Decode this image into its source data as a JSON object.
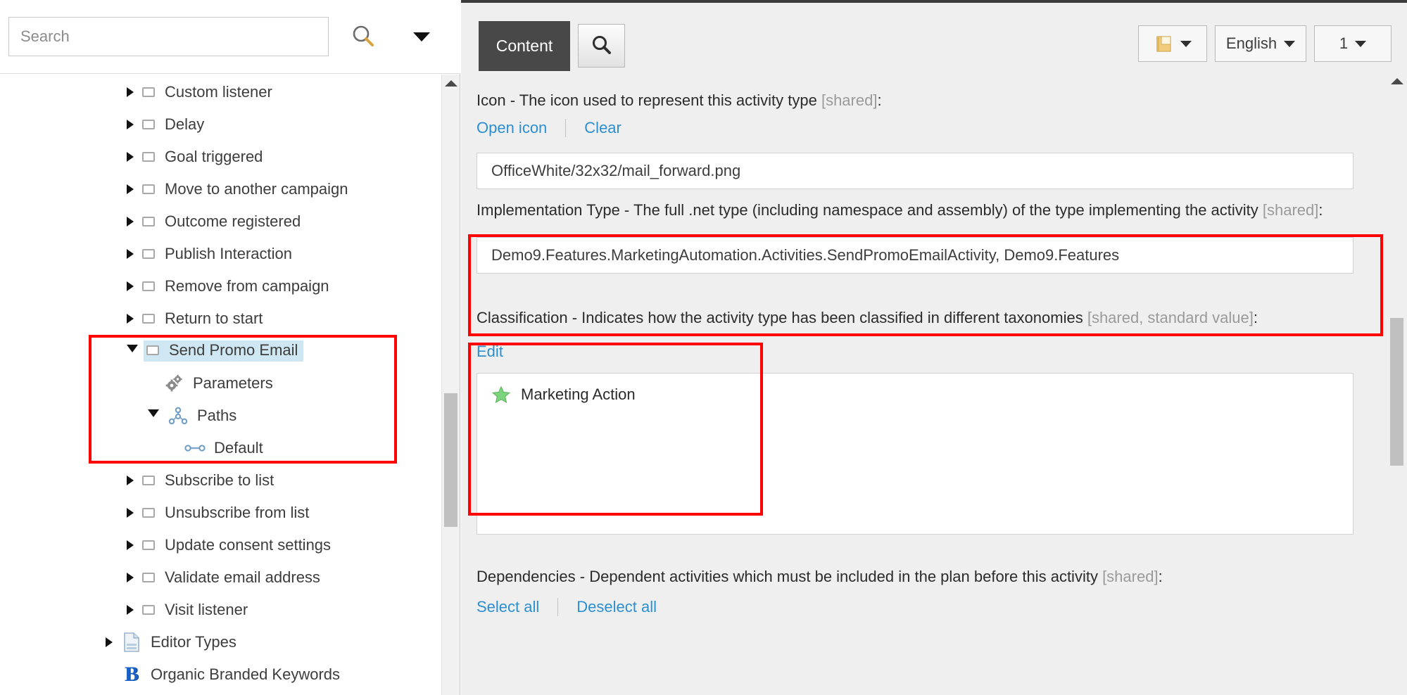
{
  "left_panel": {
    "search": {
      "placeholder": "Search",
      "value": "",
      "search_icon": "search-icon",
      "caret_icon": "chevron-down-icon"
    },
    "tree": [
      {
        "label": "Custom listener",
        "indent": 1,
        "expander": "collapsed",
        "icon": "square-icon",
        "selected": false
      },
      {
        "label": "Delay",
        "indent": 1,
        "expander": "collapsed",
        "icon": "square-icon",
        "selected": false
      },
      {
        "label": "Goal triggered",
        "indent": 1,
        "expander": "collapsed",
        "icon": "square-icon",
        "selected": false
      },
      {
        "label": "Move to another campaign",
        "indent": 1,
        "expander": "collapsed",
        "icon": "square-icon",
        "selected": false
      },
      {
        "label": "Outcome registered",
        "indent": 1,
        "expander": "collapsed",
        "icon": "square-icon",
        "selected": false
      },
      {
        "label": "Publish Interaction",
        "indent": 1,
        "expander": "collapsed",
        "icon": "square-icon",
        "selected": false
      },
      {
        "label": "Remove from campaign",
        "indent": 1,
        "expander": "collapsed",
        "icon": "square-icon",
        "selected": false
      },
      {
        "label": "Return to start",
        "indent": 1,
        "expander": "collapsed",
        "icon": "square-icon",
        "selected": false
      },
      {
        "label": "Send Promo Email",
        "indent": 1,
        "expander": "expanded",
        "icon": "square-icon",
        "selected": true
      },
      {
        "label": "Parameters",
        "indent": 2,
        "expander": "none",
        "icon": "gears-icon",
        "selected": false
      },
      {
        "label": "Paths",
        "indent": 2,
        "expander": "expanded",
        "icon": "node-tree-icon",
        "selected": false
      },
      {
        "label": "Default",
        "indent": 3,
        "expander": "none",
        "icon": "link-icon",
        "selected": false
      },
      {
        "label": "Subscribe to list",
        "indent": 1,
        "expander": "collapsed",
        "icon": "square-icon",
        "selected": false
      },
      {
        "label": "Unsubscribe from list",
        "indent": 1,
        "expander": "collapsed",
        "icon": "square-icon",
        "selected": false
      },
      {
        "label": "Update consent settings",
        "indent": 1,
        "expander": "collapsed",
        "icon": "square-icon",
        "selected": false
      },
      {
        "label": "Validate email address",
        "indent": 1,
        "expander": "collapsed",
        "icon": "square-icon",
        "selected": false
      },
      {
        "label": "Visit listener",
        "indent": 1,
        "expander": "collapsed",
        "icon": "square-icon",
        "selected": false
      },
      {
        "label": "Editor Types",
        "indent": 0,
        "expander": "collapsed",
        "icon": "document-icon",
        "selected": false
      },
      {
        "label": "Organic Branded Keywords",
        "indent": 0,
        "expander": "none",
        "icon": "b-logo-icon",
        "selected": false
      }
    ]
  },
  "right_panel": {
    "toolbar": {
      "tab_label": "Content",
      "search_button_icon": "search-icon",
      "book_button_icon": "notebook-icon",
      "language_label": "English",
      "number_label": "1",
      "caret_icon": "chevron-down-icon"
    },
    "fields": {
      "icon_field": {
        "label_main": "Icon - The icon used to represent this activity type ",
        "label_dim": "[shared]",
        "label_tail": ":",
        "link_open": "Open icon",
        "link_clear": "Clear",
        "value": "OfficeWhite/32x32/mail_forward.png"
      },
      "implementation_type": {
        "label_main": "Implementation Type - The full .net type (including namespace and assembly) of the type implementing the activity ",
        "label_dim": "[shared]",
        "label_tail": ":",
        "value": "Demo9.Features.MarketingAutomation.Activities.SendPromoEmailActivity, Demo9.Features"
      },
      "classification": {
        "label_main": "Classification - Indicates how the activity type has been classified in different taxonomies ",
        "label_dim": "[shared, standard value]",
        "label_tail": ":",
        "link_edit": "Edit",
        "items": [
          {
            "label": "Marketing Action",
            "icon": "green-star-icon"
          }
        ]
      },
      "dependencies": {
        "label_main": "Dependencies - Dependent activities which must be included in the plan before this activity ",
        "label_dim": "[shared]",
        "label_tail": ":",
        "link_select_all": "Select all",
        "link_deselect_all": "Deselect all"
      }
    }
  },
  "annotations": {
    "color": "#ff0000",
    "boxes": [
      "tree-send-promo-email-group",
      "implementation-type-field",
      "classification-field"
    ]
  }
}
